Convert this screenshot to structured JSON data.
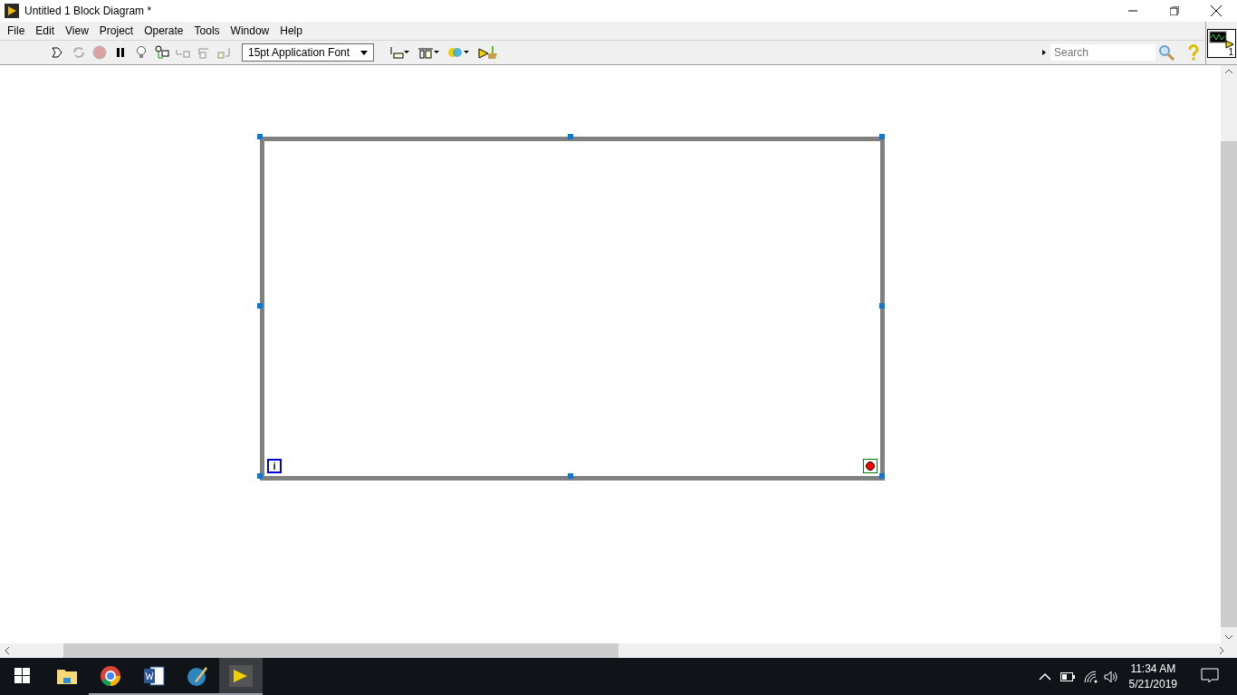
{
  "window": {
    "title": "Untitled 1 Block Diagram *"
  },
  "menu": [
    "File",
    "Edit",
    "View",
    "Project",
    "Operate",
    "Tools",
    "Window",
    "Help"
  ],
  "toolbar": [
    {
      "kind": "run",
      "disabled": false
    },
    {
      "kind": "run-continuous",
      "disabled": true
    },
    {
      "kind": "abort",
      "disabled": true
    },
    {
      "kind": "pause",
      "disabled": false
    },
    {
      "kind": "highlight",
      "disabled": false
    },
    {
      "kind": "retain",
      "disabled": false
    },
    {
      "kind": "step-into",
      "disabled": true
    },
    {
      "kind": "step-over",
      "disabled": true
    },
    {
      "kind": "step-out",
      "disabled": true
    }
  ],
  "font_select": {
    "value": "15pt Application Font"
  },
  "toolbar_right": [
    {
      "kind": "align"
    },
    {
      "kind": "distribute"
    },
    {
      "kind": "reorder"
    },
    {
      "kind": "cleanup"
    }
  ],
  "search": {
    "placeholder": "Search"
  },
  "vi_icon": {
    "number": "1"
  },
  "loop": {
    "iteration_terminal": "i"
  },
  "taskbar": {
    "apps": [
      {
        "kind": "explorer",
        "running": false,
        "selected": false
      },
      {
        "kind": "browser",
        "running": true,
        "selected": false
      },
      {
        "kind": "word",
        "running": true,
        "selected": false
      },
      {
        "kind": "pen",
        "running": true,
        "selected": false
      },
      {
        "kind": "labview",
        "running": true,
        "selected": true
      }
    ],
    "time": "11:34 AM",
    "date": "5/21/2019"
  }
}
